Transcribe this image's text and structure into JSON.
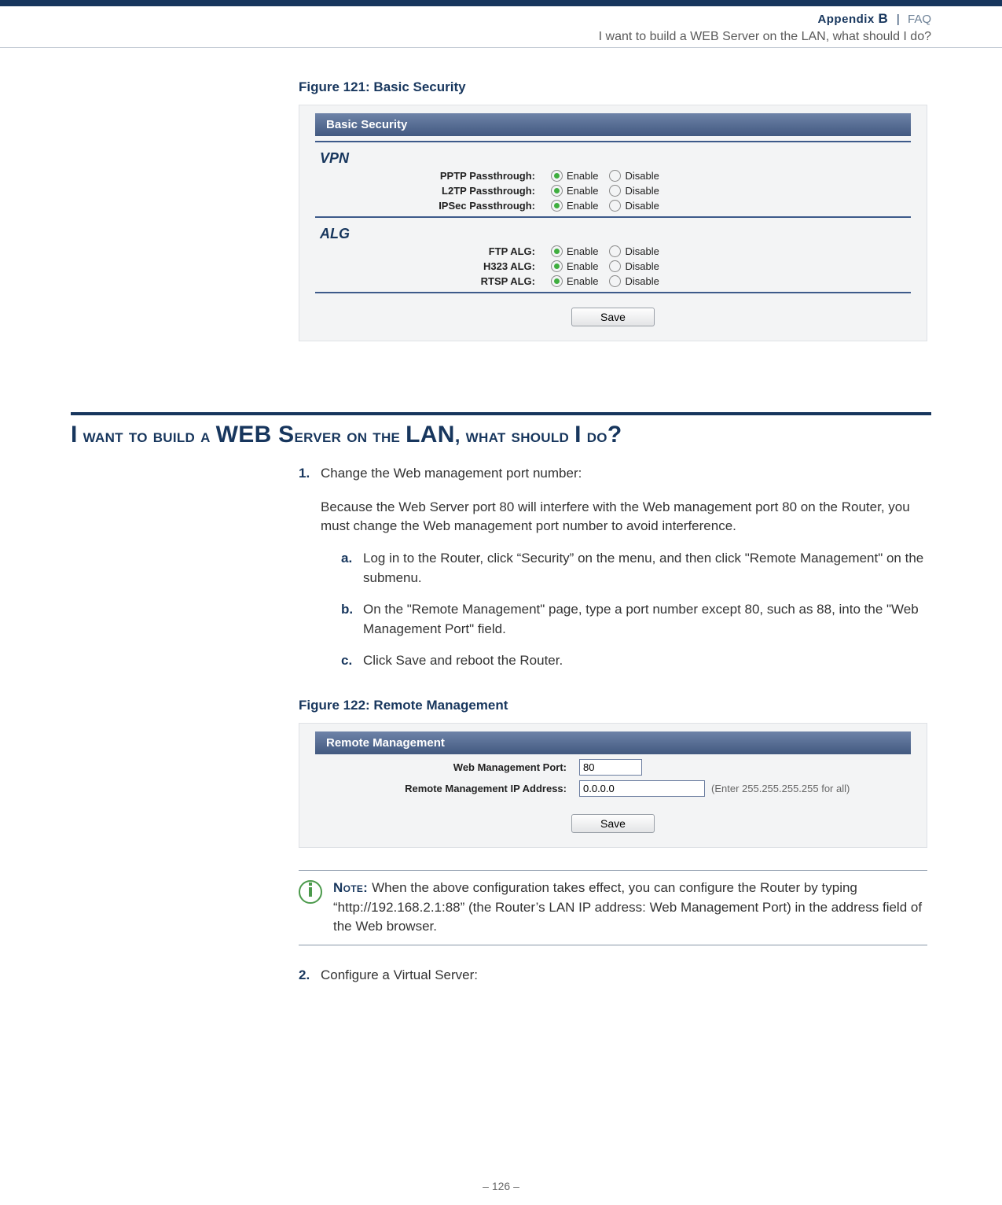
{
  "header": {
    "appendix_label": "Appendix",
    "appendix_letter": "B",
    "separator": "|",
    "faq_label": "FAQ",
    "subtitle": "I want to build a WEB Server on the LAN, what should I do?"
  },
  "figure1": {
    "caption": "Figure 121:  Basic Security",
    "panel_title": "Basic Security",
    "vpn_heading": "VPN",
    "alg_heading": "ALG",
    "enable_label": "Enable",
    "disable_label": "Disable",
    "rows_vpn": {
      "pptp": "PPTP Passthrough:",
      "l2tp": "L2TP Passthrough:",
      "ipsec": "IPSec Passthrough:"
    },
    "rows_alg": {
      "ftp": "FTP ALG:",
      "h323": "H323 ALG:",
      "rtsp": "RTSP ALG:"
    },
    "save_btn": "Save"
  },
  "section": {
    "heading_plain": "I want to build a WEB Server on the LAN, what should I do?"
  },
  "steps": {
    "s1_num": "1.",
    "s1_lead": "Change the Web management port number:",
    "s1_body": "Because the Web Server port 80 will interfere with the Web management port 80 on the Router, you must change the Web management port number to avoid interference.",
    "s1a_let": "a.",
    "s1a": "Log in to the Router, click “Security” on the menu, and then click \"Remote Management\" on the submenu.",
    "s1b_let": "b.",
    "s1b": "On the \"Remote Management\" page, type a port number except 80, such as 88, into the \"Web Management Port\" field.",
    "s1c_let": "c.",
    "s1c": "Click Save and reboot the Router.",
    "s2_num": "2.",
    "s2_lead": "Configure a Virtual Server:"
  },
  "figure2": {
    "caption": "Figure 122:  Remote Management",
    "panel_title": "Remote Management",
    "port_label": "Web Management Port:",
    "port_value": "80",
    "ip_label": "Remote Management IP Address:",
    "ip_value": "0.0.0.0",
    "ip_hint": "(Enter 255.255.255.255 for all)",
    "save_btn": "Save"
  },
  "note": {
    "label": "Note: ",
    "text": "When the above configuration takes effect, you can configure the Router by typing “http://192.168.2.1:88” (the Router’s LAN IP address: Web Management Port) in the address field of the Web browser."
  },
  "footer": {
    "page_number": "–  126  –"
  }
}
